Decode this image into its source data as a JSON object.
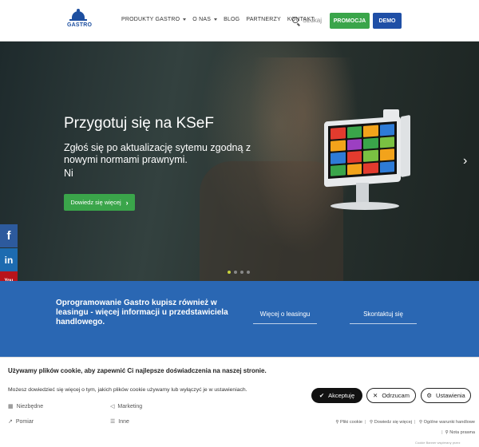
{
  "header": {
    "logo_text": "GASTRO",
    "nav": [
      {
        "label": "PRODUKTY GASTRO",
        "dropdown": true
      },
      {
        "label": "O NAS",
        "dropdown": true
      },
      {
        "label": "BLOG",
        "dropdown": false
      },
      {
        "label": "PARTNERZY",
        "dropdown": false
      },
      {
        "label": "KONTAKT",
        "dropdown": false
      }
    ],
    "search_placeholder": "Szukaj",
    "promo_label": "PROMOCJA",
    "demo_label": "DEMO"
  },
  "hero": {
    "title": "Przygotuj się na KSeF",
    "subtitle": "Zgłoś się po aktualizację sytemu zgodną z nowymi normami prawnymi.",
    "subtitle2": "Ni",
    "cta_label": "Dowiedz się więcej",
    "cta_icon": "chevron-right-icon",
    "next_arrow": "›",
    "slides_total": 4,
    "slide_active": 1
  },
  "social": {
    "facebook": "f",
    "linkedin": "in",
    "youtube": "You Tube"
  },
  "band": {
    "text": "Oprogramowanie Gastro kupisz również w leasingu - więcej informacji u przedstawiciela handlowego.",
    "link_leasing": "Więcej o leasingu",
    "link_contact": "Skontaktuj się"
  },
  "cookie": {
    "title": "Używamy plików cookie, aby zapewnić Ci najlepsze doświadczenia na naszej stronie.",
    "description": "Możesz dowiedzieć się więcej o tym, jakich plików cookie używamy lub wyłączyć je w ustawieniach.",
    "categories": [
      "Niezbędne",
      "Marketing",
      "Pomiar",
      "Inne"
    ],
    "accept_label": "Akceptuję",
    "reject_label": "Odrzucam",
    "settings_label": "Ustawienia",
    "links": [
      "Pliki cookie",
      "Dowiedz się więcej",
      "Ogólne warunki handlowe",
      "Nota prawna"
    ],
    "powered_by": "Cookie Banner wspierany przez"
  },
  "colors": {
    "accent_green": "#3aa54a",
    "brand_blue": "#1f4fa6",
    "band_blue": "#2a67b3"
  }
}
